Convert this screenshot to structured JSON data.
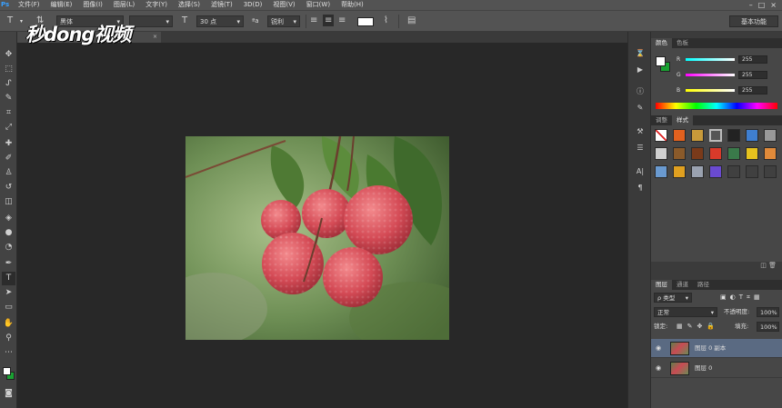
{
  "app": {
    "logo": "Ps"
  },
  "menu": [
    "文件(F)",
    "编辑(E)",
    "图像(I)",
    "图层(L)",
    "文字(Y)",
    "选择(S)",
    "滤镜(T)",
    "3D(D)",
    "视图(V)",
    "窗口(W)",
    "帮助(H)"
  ],
  "options": {
    "font_family": "黑体",
    "font_size": "30 点",
    "antialias": "锐利",
    "workspace": "基本功能"
  },
  "document_tab": {
    "label": "(B)",
    "close": "×"
  },
  "watermark": "秒dong视频",
  "color_panel": {
    "tabs": [
      "颜色",
      "色板"
    ],
    "channels": [
      {
        "label": "R",
        "value": "255"
      },
      {
        "label": "G",
        "value": "255"
      },
      {
        "label": "B",
        "value": "255"
      }
    ],
    "fg_color": "#ffffff",
    "bg_color": "#1aa032"
  },
  "styles_panel": {
    "tabs": [
      "调整",
      "样式"
    ]
  },
  "layers_panel": {
    "tabs": [
      "图层",
      "通道",
      "路径"
    ],
    "kind_filter": "ρ 类型",
    "blend_mode": "正常",
    "opacity_label": "不透明度:",
    "opacity_value": "100%",
    "lock_label": "锁定:",
    "fill_label": "填充:",
    "fill_value": "100%",
    "layers": [
      {
        "name": "图层 0 副本",
        "selected": true
      },
      {
        "name": "图层 0",
        "selected": false
      }
    ]
  }
}
